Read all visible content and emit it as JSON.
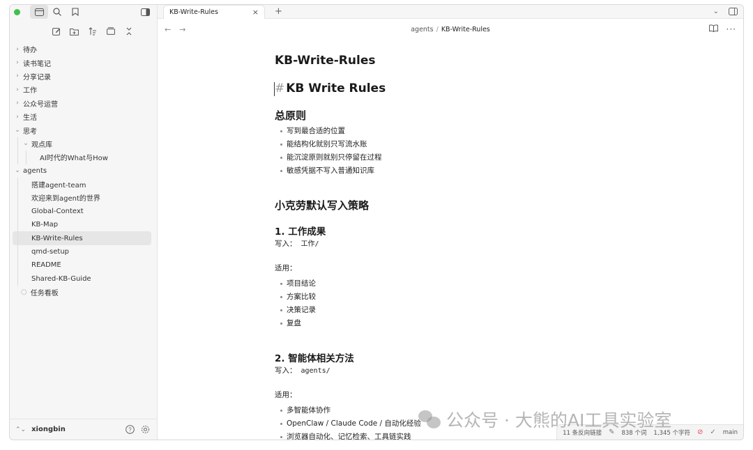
{
  "sidebar": {
    "tree": [
      {
        "label": "待办",
        "level": 0,
        "chevron": "›"
      },
      {
        "label": "读书笔记",
        "level": 0,
        "chevron": "›"
      },
      {
        "label": "分享记录",
        "level": 0,
        "chevron": "›"
      },
      {
        "label": "工作",
        "level": 0,
        "chevron": "›"
      },
      {
        "label": "公众号运营",
        "level": 0,
        "chevron": "›"
      },
      {
        "label": "生活",
        "level": 0,
        "chevron": "›"
      },
      {
        "label": "思考",
        "level": 0,
        "chevron": "⌄"
      },
      {
        "label": "观点库",
        "level": 1,
        "chevron": "⌄"
      },
      {
        "label": "AI时代的What与How",
        "level": 2,
        "chevron": ""
      },
      {
        "label": "agents",
        "level": 0,
        "chevron": "⌄"
      },
      {
        "label": "搭建agent-team",
        "level": 1,
        "chevron": ""
      },
      {
        "label": "欢迎来到agent的世界",
        "level": 1,
        "chevron": ""
      },
      {
        "label": "Global-Context",
        "level": 1,
        "chevron": ""
      },
      {
        "label": "KB-Map",
        "level": 1,
        "chevron": ""
      },
      {
        "label": "KB-Write-Rules",
        "level": 1,
        "chevron": "",
        "selected": true
      },
      {
        "label": "qmd-setup",
        "level": 1,
        "chevron": ""
      },
      {
        "label": "README",
        "level": 1,
        "chevron": ""
      },
      {
        "label": "Shared-KB-Guide",
        "level": 1,
        "chevron": ""
      },
      {
        "label": "任务看板",
        "level": 0,
        "chevron": "",
        "prefix": "◌"
      }
    ],
    "footer": {
      "vault_name": "xiongbin"
    }
  },
  "tabbar": {
    "active_tab": "KB-Write-Rules"
  },
  "breadcrumb": {
    "folder": "agents",
    "separator": "/",
    "current": "KB-Write-Rules"
  },
  "document": {
    "title": "KB-Write-Rules",
    "h1_hash": "#",
    "h1": "KB Write Rules",
    "principles_heading": "总原则",
    "principles": [
      "写到最合适的位置",
      "能结构化就别只写流水账",
      "能沉淀原则就别只停留在过程",
      "敏感凭据不写入普通知识库"
    ],
    "strategy_heading": "小克劳默认写入策略",
    "section1": {
      "heading": "1. 工作成果",
      "write_label": "写入：",
      "write_path": "工作/",
      "apply_label": "适用：",
      "items": [
        "项目结论",
        "方案比较",
        "决策记录",
        "复盘"
      ]
    },
    "section2": {
      "heading": "2. 智能体相关方法",
      "write_label": "写入：",
      "write_path": "agents/",
      "apply_label": "适用：",
      "items": [
        "多智能体协作",
        "OpenClaw / Claude Code / 自动化经验",
        "浏览器自动化、记忆检索、工具链实践"
      ]
    }
  },
  "statusbar": {
    "backlinks": "11 条反向链接",
    "words": "838 个词",
    "chars": "1,345 个字符",
    "branch": "main"
  },
  "watermark": {
    "text": "公众号 · 大熊的AI工具实验室"
  }
}
